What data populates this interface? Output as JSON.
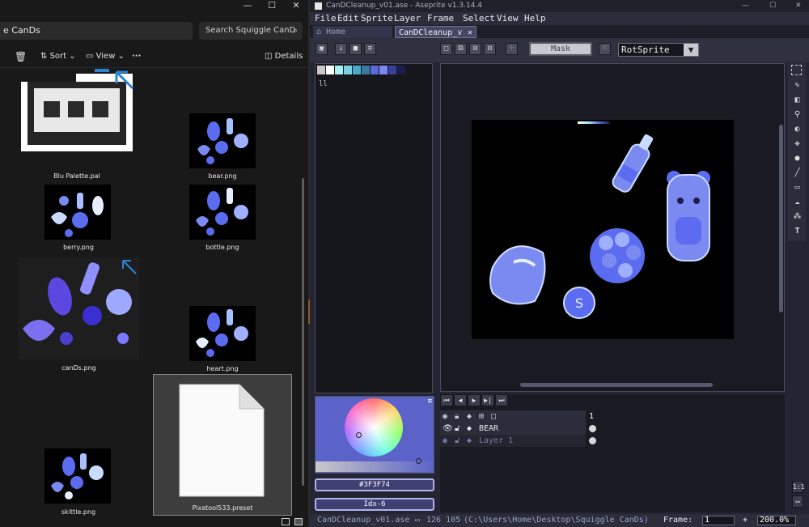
{
  "explorer": {
    "address": "e CanDs",
    "search_placeholder": "Search Squiggle CanD",
    "toolbar": {
      "sort": "Sort",
      "view": "View",
      "more": "···",
      "details": "Details"
    },
    "files": [
      {
        "name": "Blu Palette.pal"
      },
      {
        "name": "bear.png"
      },
      {
        "name": "berry.png"
      },
      {
        "name": "bottle.png"
      },
      {
        "name": "canDs.png"
      },
      {
        "name": "heart.png"
      },
      {
        "name": "skittle.png"
      },
      {
        "name": "Pixatool533.preset"
      }
    ]
  },
  "aseprite": {
    "title": "CanDCleanup_v01.ase - Aseprite v1.3.14.4",
    "menu": [
      "File",
      "Edit",
      "Sprite",
      "Layer",
      "Frame",
      "Select",
      "View",
      "Help"
    ],
    "tabs": {
      "home": "Home",
      "doc": "CanDCleanup_v"
    },
    "mask_label": "Mask",
    "rotation_algorithm": "RotSprite",
    "palette": [
      "#c8c8c8",
      "#ffffff",
      "#a6f0f8",
      "#7ecfe0",
      "#4aaacc",
      "#3a7aa0",
      "#5a6ad8",
      "#7a8af0",
      "#3a3f9a",
      "#1b1d4e"
    ],
    "color_hex": "#3F3F74",
    "color_index": "Idx-6",
    "frame_header": "1",
    "layers": [
      {
        "name": "BEAR"
      },
      {
        "name": "Layer 1"
      }
    ],
    "status": {
      "filename": "CanDCleanup_v01.ase",
      "coords": "126 105",
      "path": "(C:\\Users\\Home\\Desktop\\Squiggle CanDs)",
      "frame_label": "Frame:",
      "frame_value": "1",
      "plus": "+",
      "zoom": "200.0%"
    },
    "zoom_btn": "1:1",
    "colors": {
      "accent": "#5f63cf",
      "candy": "#5b6cf0",
      "candy_light": "#9fb0ff",
      "canvas": "#000000"
    }
  }
}
